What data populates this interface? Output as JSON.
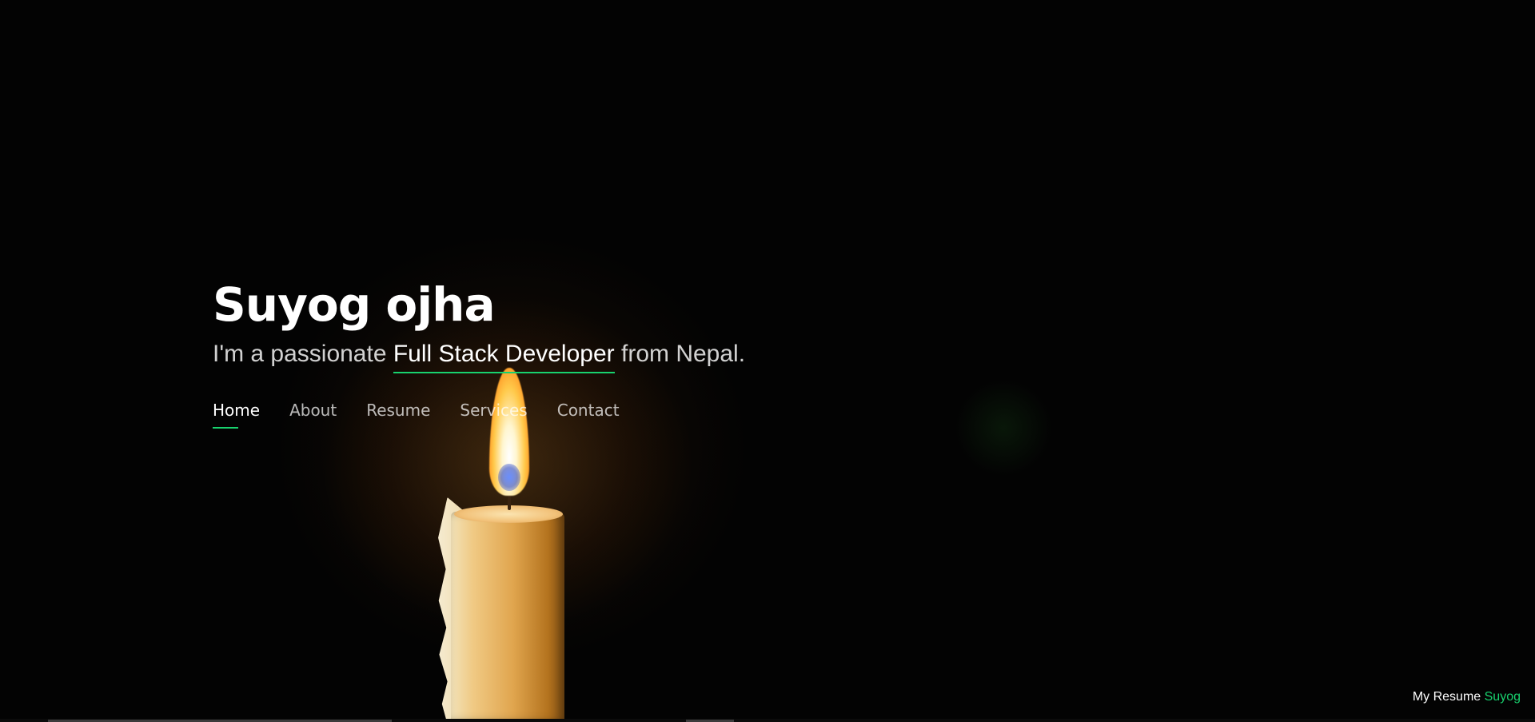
{
  "hero": {
    "name": "Suyog ojha",
    "tagline_prefix": "I'm a passionate ",
    "tagline_role": "Full Stack Developer",
    "tagline_suffix": " from Nepal."
  },
  "nav": {
    "items": [
      {
        "label": "Home",
        "active": true
      },
      {
        "label": "About",
        "active": false
      },
      {
        "label": "Resume",
        "active": false
      },
      {
        "label": "Services",
        "active": false
      },
      {
        "label": "Contact",
        "active": false
      }
    ]
  },
  "footer": {
    "credit_prefix": "My Resume ",
    "credit_name": "Suyog"
  },
  "colors": {
    "accent": "#18d26e",
    "background": "#000000",
    "text": "#ffffff"
  }
}
